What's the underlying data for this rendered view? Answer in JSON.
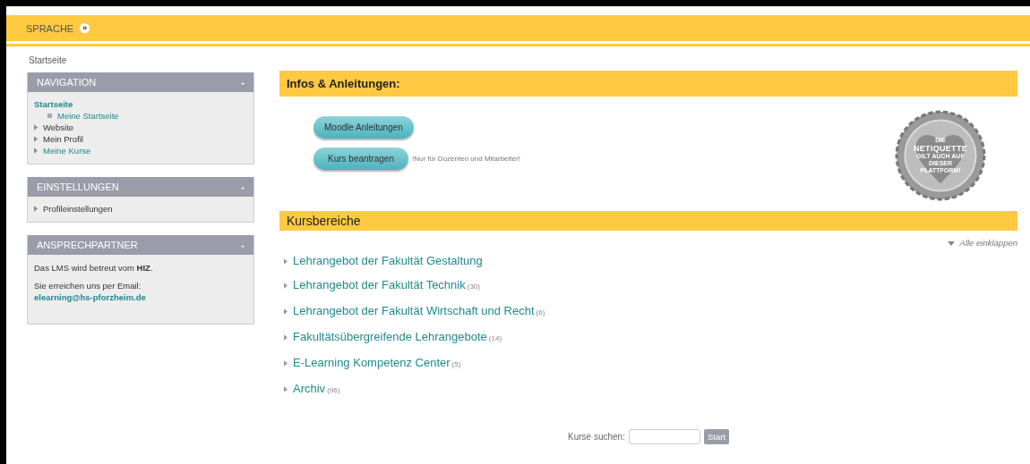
{
  "topbar": {
    "language_label": "SPRACHE",
    "arrow": "»"
  },
  "breadcrumb": "Startseite",
  "sidebar": [
    {
      "title": "NAVIGATION",
      "toggle": "-",
      "kind": "tree",
      "items": [
        {
          "label": "Startseite",
          "kind": "root",
          "link": true,
          "children": [
            {
              "label": "Meine Startseite",
              "link": true
            }
          ]
        },
        {
          "label": "Website",
          "kind": "branch",
          "link": false
        },
        {
          "label": "Mein Profil",
          "kind": "branch",
          "link": false
        },
        {
          "label": "Meine Kurse",
          "kind": "branch",
          "link": true
        }
      ]
    },
    {
      "title": "EINSTELLUNGEN",
      "toggle": "-",
      "kind": "tree",
      "items": [
        {
          "label": "Profileinstellungen",
          "kind": "branch",
          "link": false
        }
      ]
    },
    {
      "title": "ANSPRECHPARTNER",
      "toggle": "-",
      "kind": "text",
      "paragraphs": [
        "Das LMS wird betreut vom **HIZ**.",
        "Sie erreichen uns per Email:"
      ],
      "email": "elearning@hs-pforzheim.de"
    }
  ],
  "infos": {
    "title": "Infos & Anleitungen:",
    "buttons": [
      {
        "label": "Moodle Anleitungen"
      },
      {
        "label": "Kurs beantragen",
        "note": "!Nur für Dozenten und Mitarbeiter!"
      }
    ],
    "badge": {
      "lines": [
        "DIE",
        "NETIQUETTE",
        "GILT AUCH AUF",
        "DIESER",
        "PLATTFORM!"
      ]
    }
  },
  "categories": {
    "title": "Kursbereiche",
    "collapse_all": "Alle einklappen",
    "items": [
      {
        "label": "Lehrangebot der Fakultät Gestaltung"
      },
      {
        "label": "Lehrangebot der Fakultät Technik",
        "count": "(30)"
      },
      {
        "label": "Lehrangebot der Fakultät Wirtschaft und Recht",
        "count": "(6)"
      },
      {
        "label": "Fakultätsübergreifende Lehrangebote",
        "count": "(14)"
      },
      {
        "label": "E-Learning Kompetenz Center",
        "count": "(5)"
      },
      {
        "label": "Archiv",
        "count": "(96)"
      }
    ]
  },
  "search": {
    "label": "Kurse suchen:",
    "button": "Start"
  }
}
